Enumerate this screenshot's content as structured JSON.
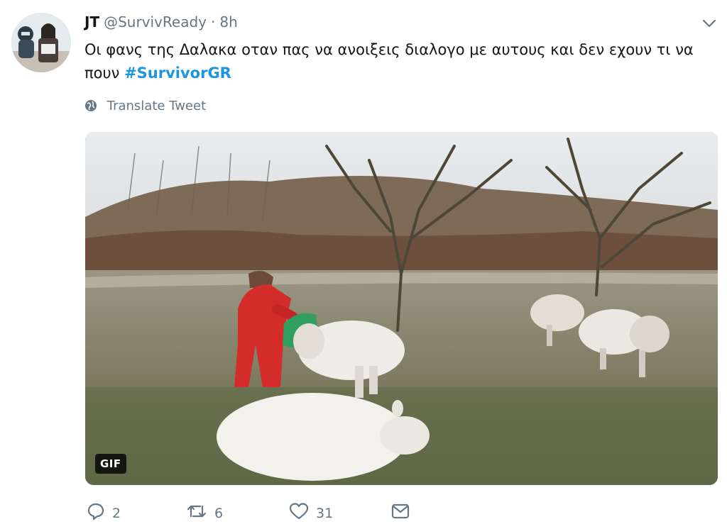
{
  "tweet": {
    "author_name": "JT",
    "handle": "@SurvivReady",
    "separator": "·",
    "time": "8h",
    "text_before_hashtag": "Οι φανς της Δαλακα οταν πας να ανοιξεις διαλογο με αυτους και δεν εχουν τι να πουν ",
    "hashtag": "#SurvivorGR",
    "translate_label": "Translate Tweet",
    "media_badge": "GIF"
  },
  "actions": {
    "replies": "2",
    "retweets": "6",
    "likes": "31"
  },
  "colors": {
    "link": "#1b95e0",
    "secondary_text": "#657786"
  },
  "icons": [
    "caret-down-icon",
    "globe-icon",
    "reply-icon",
    "retweet-icon",
    "like-icon",
    "message-icon"
  ]
}
